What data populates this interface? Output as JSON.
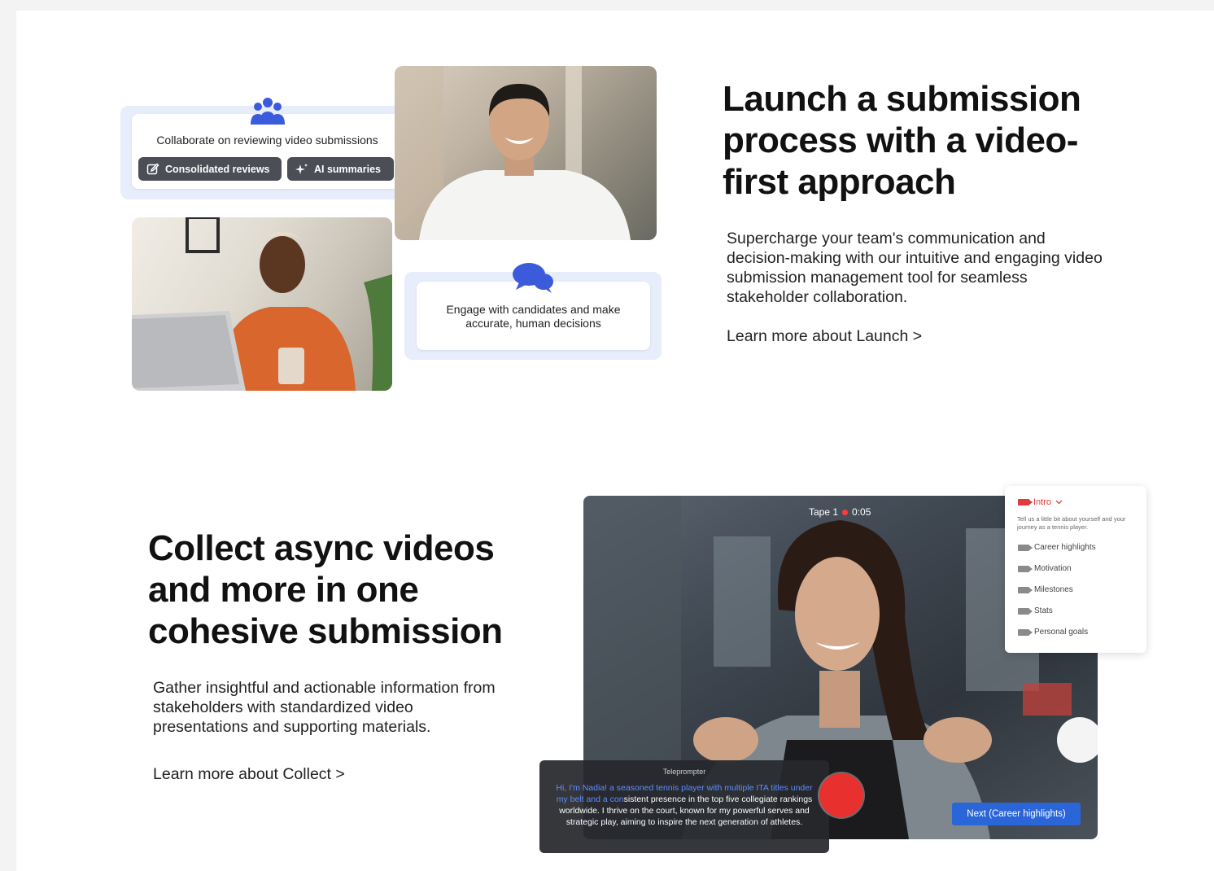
{
  "launch": {
    "card_text": "Collaborate on reviewing video submissions",
    "pill_reviews": "Consolidated reviews",
    "pill_ai": "AI summaries",
    "engage_line1": "Engage with candidates and make",
    "engage_line2": "accurate, human decisions",
    "heading": "Launch a submission process with a video-first approach",
    "body": "Supercharge your team's communication and decision-making with our intuitive and engaging video submission management tool for seamless stakeholder collaboration.",
    "link": "Learn more about Launch >"
  },
  "collect": {
    "heading": "Collect async videos and more in one cohesive submission",
    "body": "Gather insightful and actionable information from stakeholders with standardized video presentations and supporting materials.",
    "link": "Learn more about Collect >",
    "tape": "Tape 1",
    "time": "0:05",
    "intro": {
      "title": "Intro",
      "desc": "Tell us a little bit about yourself and your journey as a tennis player.",
      "items": [
        "Career highlights",
        "Motivation",
        "Milestones",
        "Stats",
        "Personal goals"
      ]
    },
    "teleprompter": {
      "title": "Teleprompter",
      "read": "Hi, I'm Nadia! a seasoned tennis player with multiple ITA titles under my belt and a con",
      "unread": "sistent presence in the top five collegiate rankings worldwide. I thrive on the court, known for my powerful serves and strategic play, aiming to inspire the next generation of athletes."
    },
    "next_button": "Next (Career highlights)"
  },
  "colors": {
    "accent_blue": "#3b5bdb",
    "record_red": "#e8302e",
    "button_blue": "#2b66d9",
    "card_tint": "#e7edfb"
  },
  "icons": [
    "people-group-icon",
    "edit-icon",
    "sparkle-icon",
    "chat-bubbles-icon",
    "video-camera-icon",
    "chevron-down-icon"
  ]
}
